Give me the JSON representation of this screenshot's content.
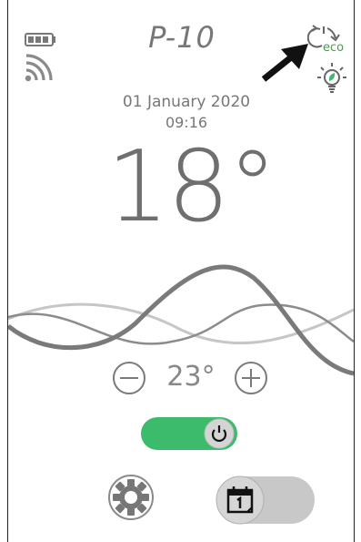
{
  "header": {
    "title": "P-10",
    "eco_label": "eco"
  },
  "status": {
    "date": "01 January 2020",
    "time": "09:16",
    "current_temperature": "18°"
  },
  "controls": {
    "setpoint": "23°",
    "power_toggle_on": true,
    "schedule_toggle_on": false
  },
  "icons": {
    "battery": "battery-icon",
    "signal": "wifi-signal-icon",
    "eco_mode": "eco-mode-icon",
    "eco_bulb": "eco-bulb-icon",
    "pointer_arrow": "arrow-pointer-icon",
    "decrease": "minus-circle-icon",
    "increase": "plus-circle-icon",
    "power": "power-icon",
    "settings": "gear-icon",
    "calendar": "calendar-icon"
  },
  "colors": {
    "accent_green": "#3dbb6c",
    "text_gray": "#777777",
    "toggle_off_gray": "#c8c8c8"
  }
}
